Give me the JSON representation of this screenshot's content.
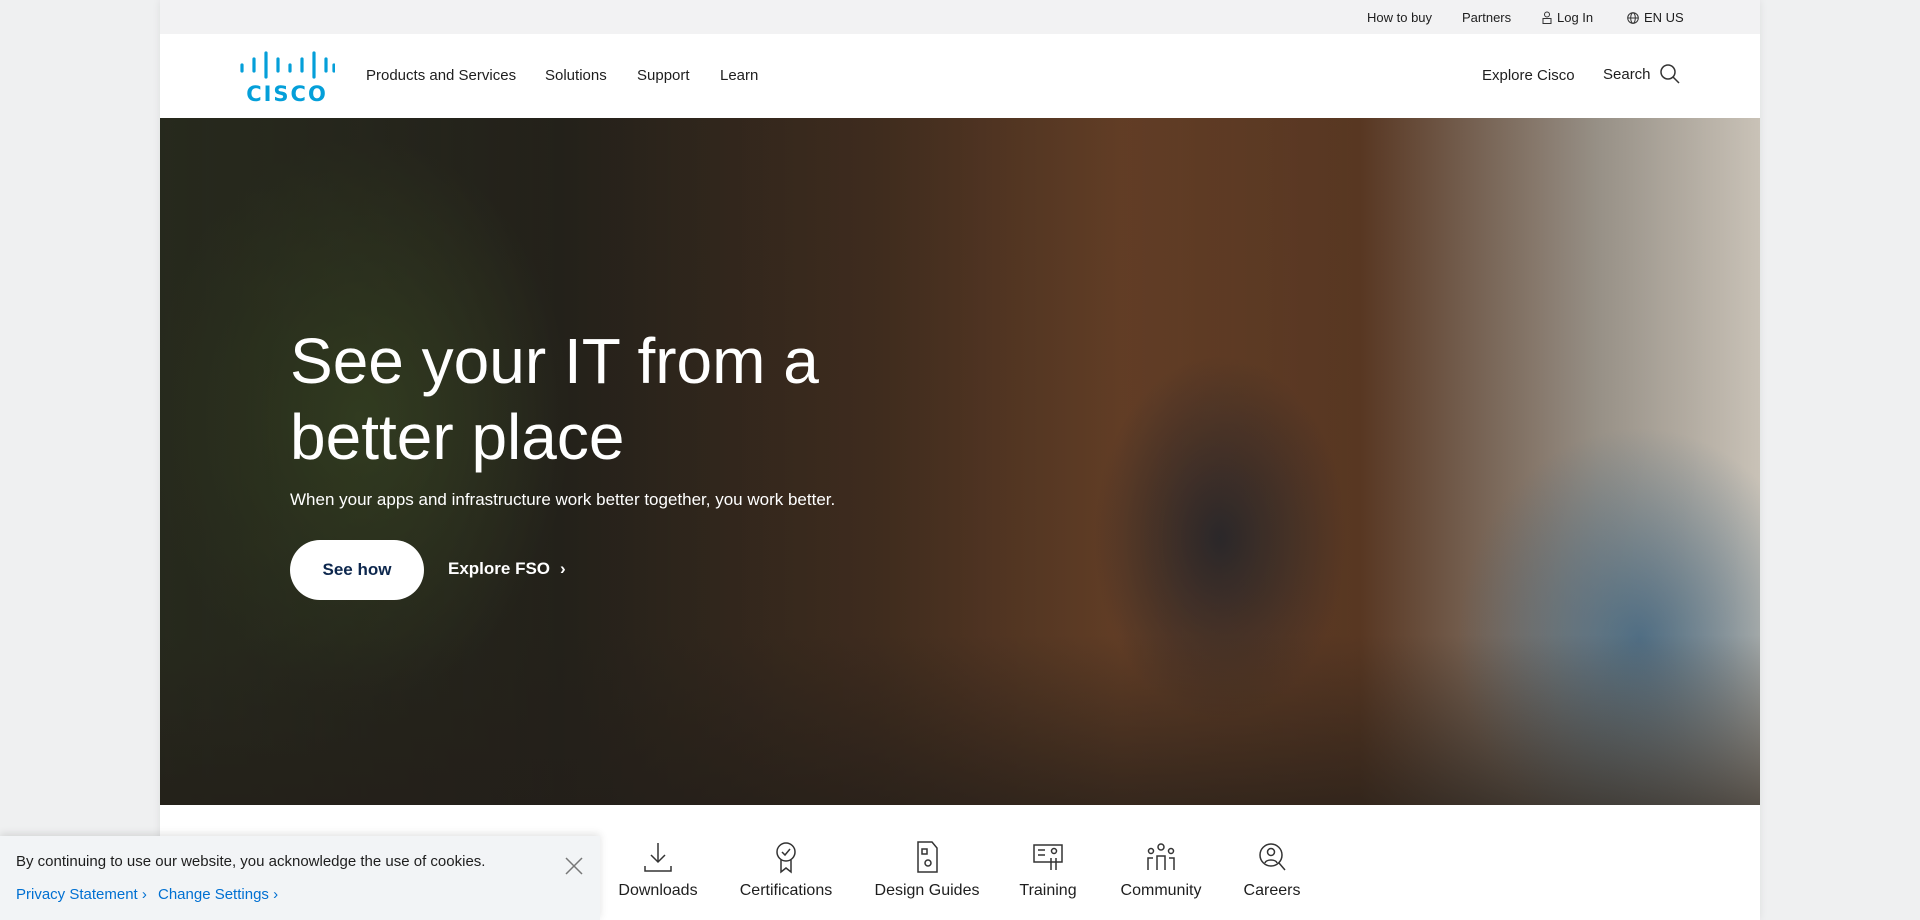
{
  "topbar": {
    "how_to_buy": "How to buy",
    "partners": "Partners",
    "log_in": "Log In",
    "language": "EN US"
  },
  "header": {
    "logo": "cisco",
    "nav": [
      "Products and Services",
      "Solutions",
      "Support",
      "Learn"
    ],
    "explore": "Explore Cisco",
    "search": "Search"
  },
  "hero": {
    "headline": "See your IT from a better place",
    "subtitle": "When your apps and infrastructure work better together, you work better.",
    "primary_cta": "See how",
    "secondary_cta": "Explore FSO"
  },
  "tiles": [
    {
      "label": "Downloads",
      "icon": "download-icon"
    },
    {
      "label": "Certifications",
      "icon": "certificate-icon"
    },
    {
      "label": "Design Guides",
      "icon": "document-icon"
    },
    {
      "label": "Training",
      "icon": "training-icon"
    },
    {
      "label": "Community",
      "icon": "community-icon"
    },
    {
      "label": "Careers",
      "icon": "careers-icon"
    }
  ],
  "cookie": {
    "message": "By continuing to use our website, you acknowledge the use of cookies.",
    "privacy": "Privacy Statement",
    "settings": "Change Settings"
  },
  "colors": {
    "brand": "#049fd9",
    "link": "#0070d2",
    "cta_text": "#0d274d"
  }
}
